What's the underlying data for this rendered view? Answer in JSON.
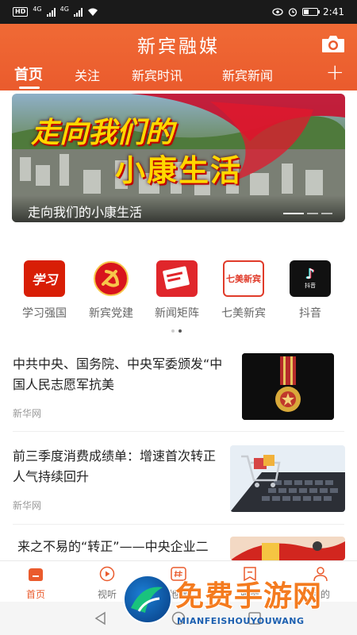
{
  "status_bar": {
    "sim_label": "HD",
    "net1": "4G",
    "net2": "4G",
    "time": "2:41"
  },
  "header": {
    "app_title": "新宾融媒",
    "camera_icon": "camera-icon",
    "tabs": [
      {
        "label": "首页",
        "active": true
      },
      {
        "label": "关注",
        "active": false
      },
      {
        "label": "新宾时讯",
        "active": false
      },
      {
        "label": "新宾新闻",
        "active": false
      }
    ],
    "add_label": "+"
  },
  "banner": {
    "heading_line1": "走向我们的",
    "heading_line2": "小康生活",
    "caption": "走向我们的小康生活"
  },
  "shortcuts": [
    {
      "label": "学习强国",
      "icon": "xuexi-icon",
      "badge": "学习"
    },
    {
      "label": "新宾党建",
      "icon": "party-emblem-icon",
      "badge": ""
    },
    {
      "label": "新闻矩阵",
      "icon": "news-matrix-icon",
      "badge": ""
    },
    {
      "label": "七美新宾",
      "icon": "qimei-icon",
      "badge": "七美新宾"
    },
    {
      "label": "抖音",
      "icon": "douyin-icon",
      "badge": "抖音"
    }
  ],
  "news": [
    {
      "title": "中共中央、国务院、中央军委颁发“中国人民志愿军抗美",
      "source": "新华网",
      "thumb": "medal-image"
    },
    {
      "title": "前三季度消费成绩单：增速首次转正 人气持续回升",
      "source": "新华网",
      "thumb": "shopping-cart-keyboard-image"
    },
    {
      "title": "来之不易的“转正”——中央企业二季…",
      "source": "",
      "thumb": "red-banner-image"
    }
  ],
  "bottom_nav": [
    {
      "label": "首页",
      "icon": "home-icon",
      "active": true
    },
    {
      "label": "视听",
      "icon": "play-icon",
      "active": false
    },
    {
      "label": "地标",
      "icon": "hashtag-icon",
      "active": false
    },
    {
      "label": "服务",
      "icon": "bookmark-icon",
      "active": false
    },
    {
      "label": "我的",
      "icon": "user-icon",
      "active": false
    }
  ],
  "watermark": {
    "text": "免费手游网",
    "sub": "MIANFEISHOUYOUWANG"
  },
  "colors": {
    "accent": "#ea5b2d",
    "status_bar": "#1a1a1a",
    "source_text": "#999999"
  }
}
